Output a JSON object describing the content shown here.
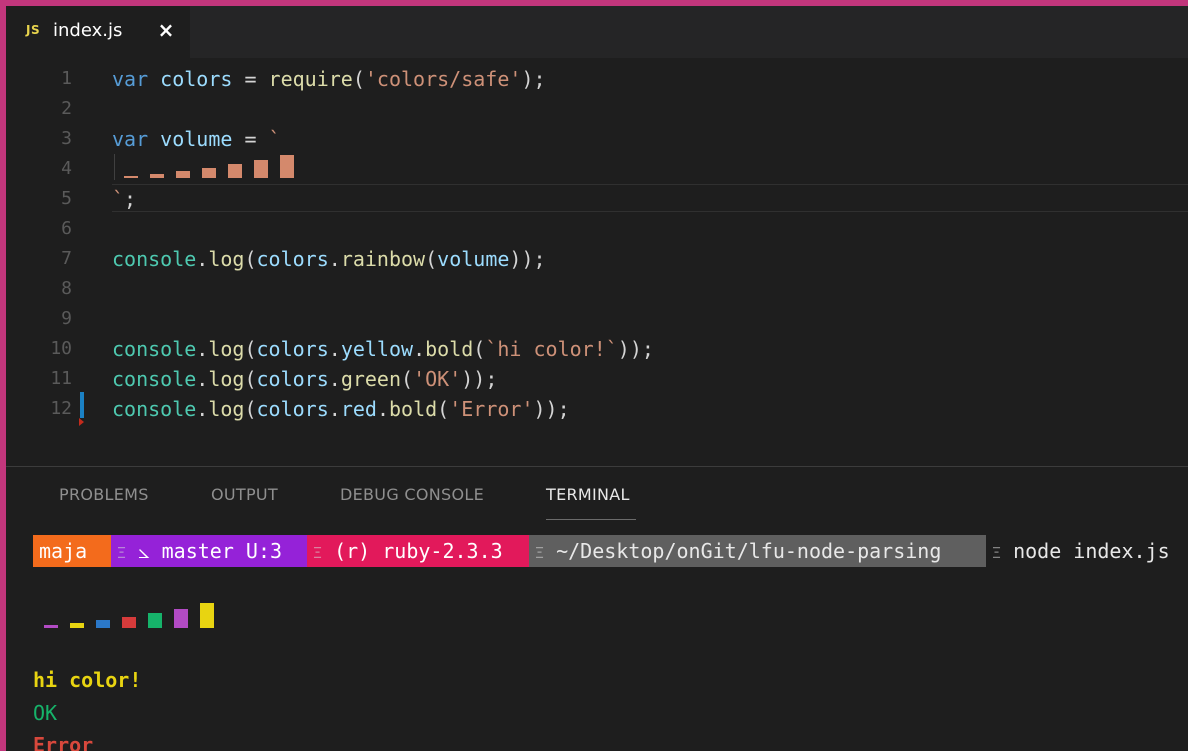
{
  "tab": {
    "icon_label": "JS",
    "filename": "index.js",
    "close_glyph": "×"
  },
  "editor": {
    "line_numbers": [
      "1",
      "2",
      "3",
      "4",
      "5",
      "6",
      "7",
      "8",
      "9",
      "10",
      "11",
      "12"
    ],
    "lines": {
      "l1": {
        "kw": "var",
        "name": "colors",
        "op": " = ",
        "fn": "require",
        "open": "(",
        "str": "'colors/safe'",
        "close": ");"
      },
      "l3": {
        "kw": "var",
        "name": "volume",
        "op": " = ",
        "str": "`"
      },
      "l5": {
        "str": "`",
        "close": ";"
      },
      "l7": {
        "obj": "console",
        "dot": ".",
        "fn": "log",
        "open": "(",
        "arg": "colors",
        "dot2": ".",
        "fn2": "rainbow",
        "open2": "(",
        "arg2": "volume",
        "close": "));"
      },
      "l10": {
        "obj": "console",
        "dot": ".",
        "fn": "log",
        "open": "(",
        "arg": "colors",
        "dot2": ".",
        "prop": "yellow",
        "dot3": ".",
        "fn2": "bold",
        "open2": "(",
        "str": "`hi color!`",
        "close": "));"
      },
      "l11": {
        "obj": "console",
        "dot": ".",
        "fn": "log",
        "open": "(",
        "arg": "colors",
        "dot2": ".",
        "fn2": "green",
        "open2": "(",
        "str": "'OK'",
        "close": "));"
      },
      "l12": {
        "obj": "console",
        "dot": ".",
        "fn": "log",
        "open": "(",
        "arg": "colors",
        "dot2": ".",
        "prop": "red",
        "dot3": ".",
        "fn2": "bold",
        "open2": "(",
        "str": "'Error'",
        "close": "));"
      }
    }
  },
  "panel": {
    "tabs": [
      "PROBLEMS",
      "OUTPUT",
      "DEBUG CONSOLE",
      "TERMINAL"
    ],
    "active_tab": "TERMINAL"
  },
  "terminal": {
    "prompt": {
      "user": "maja",
      "git": "⦣ master U:3",
      "ruby": "(r) ruby-2.3.3",
      "path": "~/Desktop/onGit/lfu-node-parsing",
      "command": "node index.js",
      "separator": "Ξ"
    },
    "output_lines": [
      "hi color!",
      "OK",
      "Error"
    ]
  },
  "colors": {
    "user_bg": "#f36b1c",
    "git_bg": "#9522d8",
    "ruby_bg": "#e2195b",
    "path_bg": "#5f5f5f",
    "rainbow": [
      "#b24bc4",
      "#e8d411",
      "#2b78c8",
      "#d63b3b",
      "#16b36a",
      "#b24bc4",
      "#e8d411"
    ],
    "yellow": "#e8d411",
    "green": "#16b36a",
    "red": "#d8483c"
  }
}
